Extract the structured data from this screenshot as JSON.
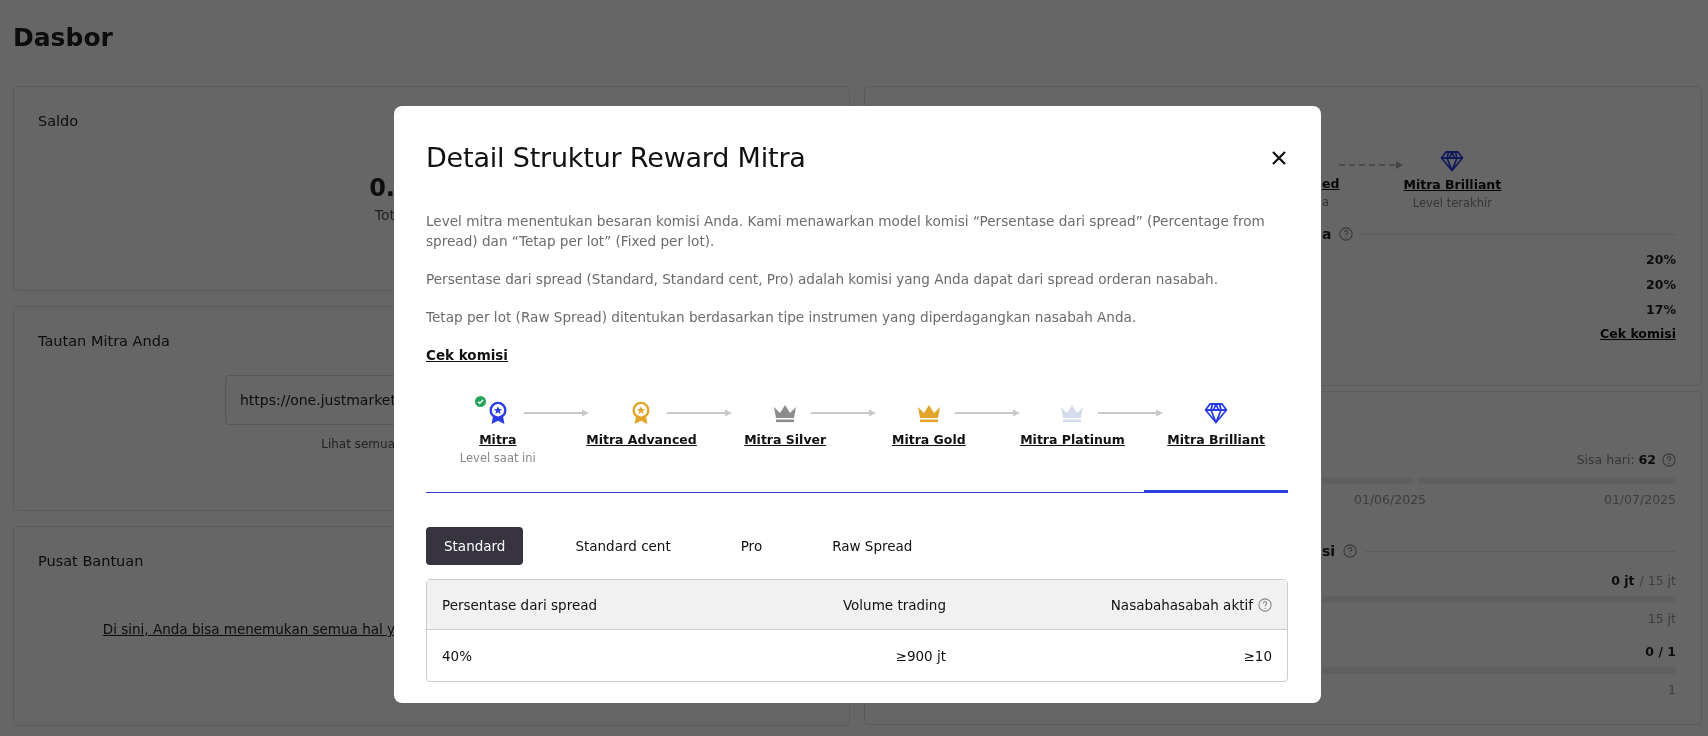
{
  "page": {
    "title": "Dasbor"
  },
  "balance_card": {
    "title": "Saldo",
    "amount": "0.",
    "amount_label": "Tot"
  },
  "link_card": {
    "title": "Tautan Mitra Anda",
    "link_field": "https://one.justmarket",
    "note": "Lihat semua"
  },
  "help_card": {
    "title": "Pusat Bantuan",
    "link": "Di sini, Anda bisa menemukan semua hal y"
  },
  "level_card": {
    "prev_step": {
      "label": "ed",
      "sublabel": "a"
    },
    "last_step": {
      "label": "Mitra Brilliant",
      "sublabel": "Level terakhir"
    },
    "section_title": "a",
    "rates": [
      "20%",
      "20%",
      "17%"
    ],
    "link": "Cek komisi"
  },
  "progress_card": {
    "days_label": "Sisa hari:",
    "days_value": "62",
    "dates": [
      "01/06/2025",
      "01/07/2025"
    ],
    "section_title": "si",
    "volume": {
      "value": "0 jt",
      "target": "/ 15 jt",
      "end_label": "15 jt"
    },
    "clients": {
      "value": "0 / 1",
      "end_label": "1"
    }
  },
  "modal": {
    "title": "Detail Struktur Reward Mitra",
    "paragraphs": [
      "Level mitra menentukan besaran komisi Anda. Kami menawarkan model komisi “Persentase dari spread” (Percentage from spread) dan “Tetap per lot” (Fixed per lot).",
      "Persentase dari spread (Standard, Standard cent, Pro) adalah komisi yang Anda dapat dari spread orderan nasabah.",
      "Tetap per lot (Raw Spread) ditentukan berdasarkan tipe instrumen yang diperdagangkan nasabah Anda."
    ],
    "link": "Cek komisi",
    "steps": [
      {
        "label": "Mitra",
        "sublabel": "Level saat ini",
        "kind": "medal",
        "color": "#2b3ee6",
        "current": true,
        "selected": false
      },
      {
        "label": "Mitra Advanced",
        "kind": "medal",
        "color": "#e2a52a",
        "current": false,
        "selected": false
      },
      {
        "label": "Mitra Silver",
        "kind": "crown",
        "color": "#8c8c8c",
        "current": false,
        "selected": false
      },
      {
        "label": "Mitra Gold",
        "kind": "crown",
        "color": "#e2a52a",
        "current": false,
        "selected": false
      },
      {
        "label": "Mitra Platinum",
        "kind": "crown",
        "color": "#d3dbec",
        "current": false,
        "selected": false
      },
      {
        "label": "Mitra Brilliant",
        "kind": "diamond",
        "color": "#2b3ee6",
        "current": false,
        "selected": true
      }
    ],
    "tabs": [
      {
        "label": "Standard",
        "selected": true
      },
      {
        "label": "Standard cent",
        "selected": false
      },
      {
        "label": "Pro",
        "selected": false
      },
      {
        "label": "Raw Spread",
        "selected": false
      }
    ],
    "table": {
      "columns": [
        {
          "label": "Persentase dari spread",
          "help": false
        },
        {
          "label": "Volume trading",
          "help": false
        },
        {
          "label": "Nasabahasabah aktif",
          "help": true
        }
      ],
      "rows": [
        [
          "40%",
          "≥900 jt",
          "≥10"
        ]
      ]
    }
  }
}
